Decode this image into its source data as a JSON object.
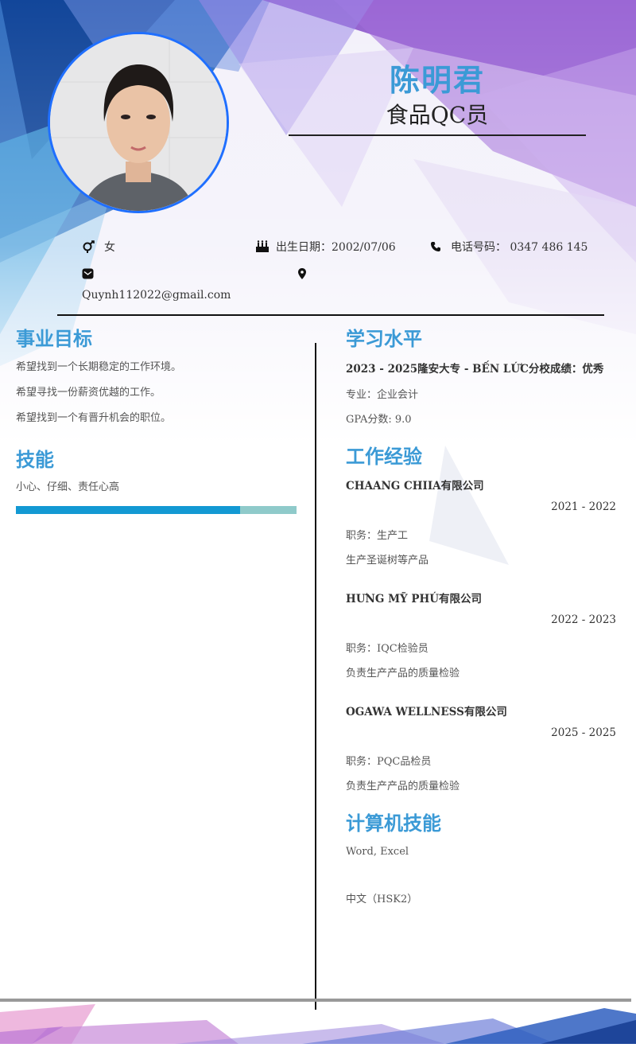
{
  "profile": {
    "name": "陈明君",
    "job_title": "食品QC员",
    "gender": "女",
    "birth_label": "出生日期：",
    "birth_date": "2002/07/06",
    "phone_label": "电话号码：",
    "phone": "0347 486 145",
    "email": "Quynh112022@gmail.com",
    "address": ""
  },
  "career_goal": {
    "title": "事业目标",
    "items": [
      "希望找到一个长期稳定的工作环境。",
      "希望寻找一份薪资优越的工作。",
      "希望找到一个有晋升机会的职位。"
    ]
  },
  "skills": {
    "title": "技能",
    "text": "小心、仔细、责任心高",
    "level": 0.8
  },
  "education": {
    "title": "学习水平",
    "school_line": "2023 - 2025隆安大专 - BẾN LỨC分校成绩：优秀",
    "major": "专业：企业会计",
    "gpa": "GPA分数: 9.0"
  },
  "work": {
    "title": "工作经验",
    "jobs": [
      {
        "company": "CHAANG CHIIA有限公司",
        "period": "2021 - 2022",
        "role": "职务：生产工",
        "desc": "生产圣诞树等产品"
      },
      {
        "company": "HƯNG MỸ PHÚ有限公司",
        "period": "2022 - 2023",
        "role": "职务：IQC检验员",
        "desc": "负责生产产品的质量检验"
      },
      {
        "company": "OGAWA WELLNESS有限公司",
        "period": "2025 - 2025",
        "role": "职务：PQC品检员",
        "desc": "负责生产产品的质量检验"
      }
    ]
  },
  "computer": {
    "title": "计算机技能",
    "software": "Word, Excel",
    "language": "中文（HSK2）"
  }
}
